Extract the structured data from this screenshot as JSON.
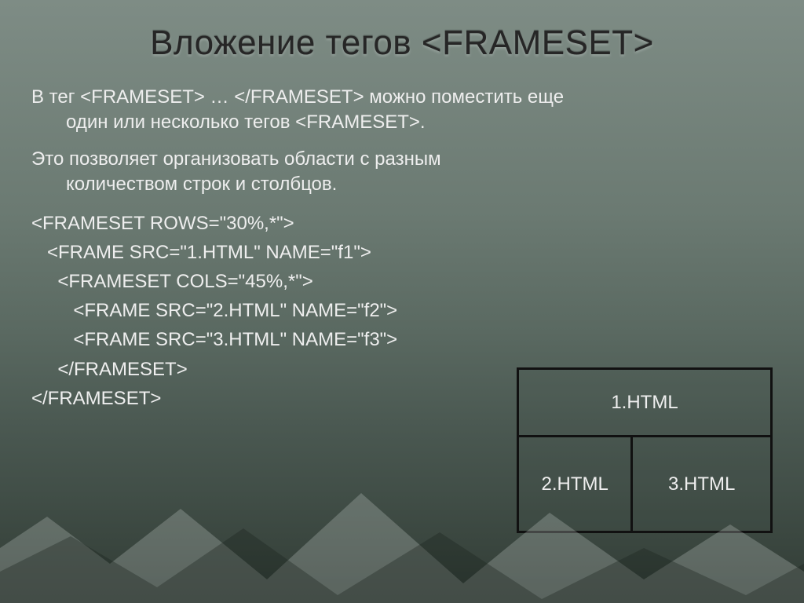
{
  "title": "Вложение тегов <FRAMESET>",
  "para1_line1": "В тег <FRAMESET> … </FRAMESET> можно поместить еще",
  "para1_line2": "один или несколько тегов <FRAMESET>.",
  "para2_line1": "Это позволяет организовать области с разным",
  "para2_line2": "количеством строк и столбцов.",
  "code": {
    "l1": "<FRAMESET ROWS=\"30%,*\">",
    "l2": "   <FRAME SRC=\"1.HTML\" NAME=\"f1\">",
    "l3": "     <FRAMESET COLS=\"45%,*\">",
    "l4": "        <FRAME SRC=\"2.HTML\" NAME=\"f2\">",
    "l5": "        <FRAME SRC=\"3.HTML\" NAME=\"f3\">",
    "l6": "     </FRAMESET>",
    "l7": "</FRAMESET>"
  },
  "diagram": {
    "cell1": "1.HTML",
    "cell2": "2.HTML",
    "cell3": "3.HTML"
  }
}
